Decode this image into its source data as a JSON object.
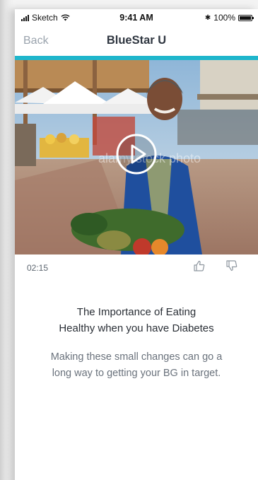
{
  "status_bar": {
    "carrier": "Sketch",
    "time": "9:41 AM",
    "battery": "100%",
    "bluetooth_symbol": "✱"
  },
  "nav": {
    "back_label": "Back",
    "title": "BlueStar U"
  },
  "video": {
    "duration": "02:15",
    "play_icon": "play-icon",
    "watermark": "alamy stock photo"
  },
  "feedback": {
    "like_icon": "thumbs-up-icon",
    "dislike_icon": "thumbs-down-icon"
  },
  "article": {
    "headline_line1": "The Importance of Eating",
    "headline_line2": "Healthy when you have Diabetes",
    "body_line1": "Making these small changes can go a",
    "body_line2": "long way to getting your BG in target."
  },
  "colors": {
    "accent": "#1fb6cc",
    "back": "#9aa3ad",
    "title": "#2f3640"
  }
}
